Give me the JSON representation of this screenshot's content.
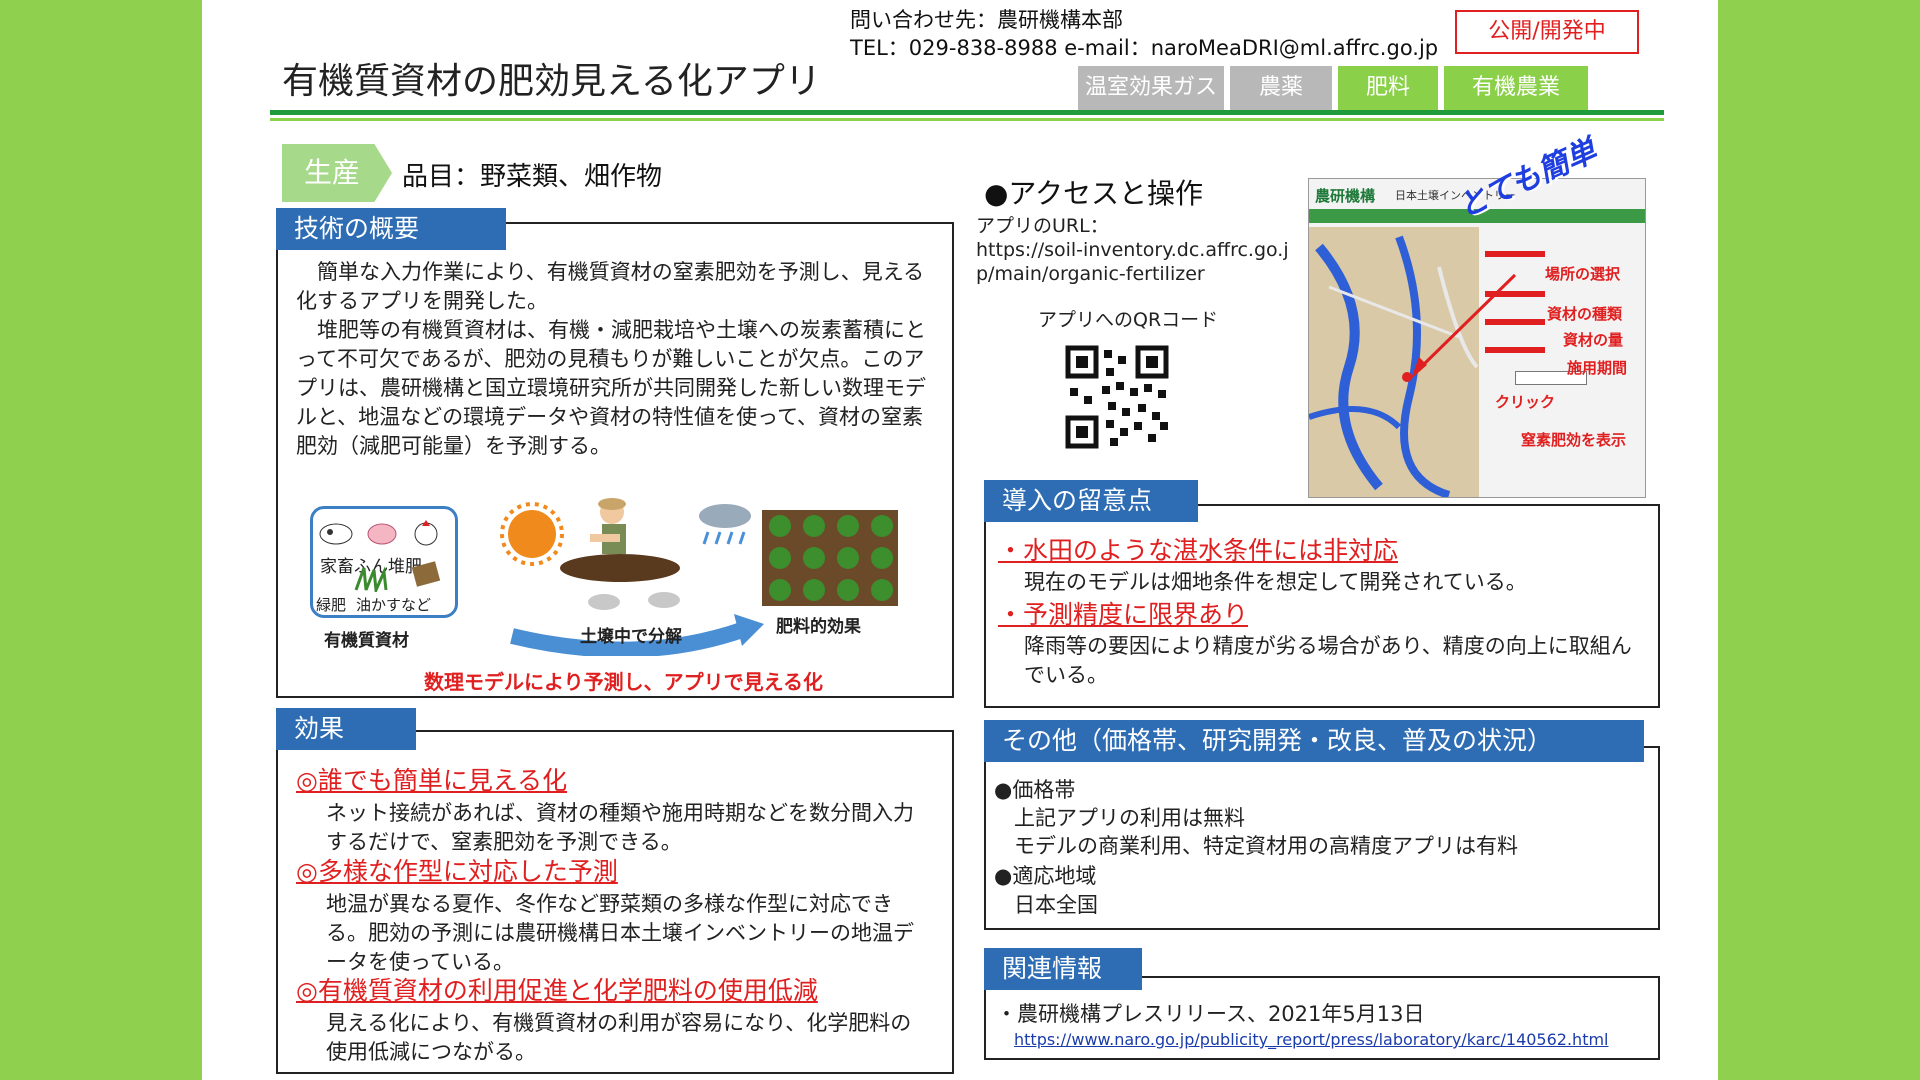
{
  "header": {
    "title": "有機質資材の肥効見える化アプリ",
    "contact_line1": "問い合わせ先：農研機構本部",
    "contact_line2": "TEL：029-838-8988 e-mail：naroMeaDRI@ml.affrc.go.jp",
    "status": "公開/開発中",
    "tabs": [
      "温室効果ガス",
      "農薬",
      "肥料",
      "有機農業"
    ]
  },
  "product": {
    "tag": "生産",
    "label": "品目：野菜類、畑作物"
  },
  "overview": {
    "heading": "技術の概要",
    "text": "　簡単な入力作業により、有機質資材の窒素肥効を予測し、見える化するアプリを開発した。\n　堆肥等の有機質資材は、有機・減肥栽培や土壌への炭素蓄積にとって不可欠であるが、肥効の見積もりが難しいことが欠点。このアプリは、農研機構と国立環境研究所が共同開発した新しい数理モデルと、地温などの環境データや資材の特性値を使って、資材の窒素肥効（減肥可能量）を予測する。",
    "diagram": {
      "inner_label_1": "家畜ふん堆肥",
      "inner_label_2": "緑肥",
      "inner_label_3": "油かすなど",
      "label_materials": "有機質資材",
      "label_decompose": "土壌中で分解",
      "label_effect": "肥料的効果",
      "caption": "数理モデルにより予測し、アプリで見える化"
    }
  },
  "effects": {
    "heading": "効果",
    "items": [
      {
        "title": "◎誰でも簡単に見える化",
        "text": "ネット接続があれば、資材の種類や施用時期などを数分間入力するだけで、窒素肥効を予測できる。"
      },
      {
        "title": "◎多様な作型に対応した予測",
        "text": "地温が異なる夏作、冬作など野菜類の多様な作型に対応できる。肥効の予測には農研機構日本土壌インベントリーの地温データを使っている。"
      },
      {
        "title": "◎有機質資材の利用促進と化学肥料の使用低減",
        "text": "見える化により、有機質資材の利用が容易になり、化学肥料の使用低減につながる。"
      }
    ]
  },
  "access": {
    "heading": "●アクセスと操作",
    "url_label": "アプリのURL：",
    "url": "https://soil-inventory.dc.affrc.go.jp/main/organic-fertilizer",
    "qr_label": "アプリへのQRコード",
    "screenshot": {
      "logo": "農研機構",
      "site": "日本土壌インベントリー",
      "banner": "とても簡単",
      "labels": [
        "場所の選択",
        "資材の種類",
        "資材の量",
        "施用期間",
        "クリック",
        "窒素肥効を表示"
      ]
    }
  },
  "notes": {
    "heading": "導入の留意点",
    "items": [
      {
        "title": "・水田のような湛水条件には非対応",
        "text": "現在のモデルは畑地条件を想定して開発されている。"
      },
      {
        "title": "・予測精度に限界あり",
        "text": "降雨等の要因により精度が劣る場合があり、精度の向上に取組んでいる。"
      }
    ]
  },
  "other": {
    "heading": "その他（価格帯、研究開発・改良、普及の状況）",
    "lines": [
      "●価格帯",
      "上記アプリの利用は無料",
      "モデルの商業利用、特定資材用の高精度アプリは有料",
      "●適応地域",
      "日本全国"
    ]
  },
  "related": {
    "heading": "関連情報",
    "item": "・農研機構プレスリリース、2021年5月13日",
    "link": "https://www.naro.go.jp/publicity_report/press/laboratory/karc/140562.html"
  },
  "colors": {
    "background": "#8fd14f",
    "section_blue": "#2e6db4",
    "accent_red": "#e02020",
    "tab_green": "#8bd049",
    "tab_gray": "#b8b8b8"
  }
}
